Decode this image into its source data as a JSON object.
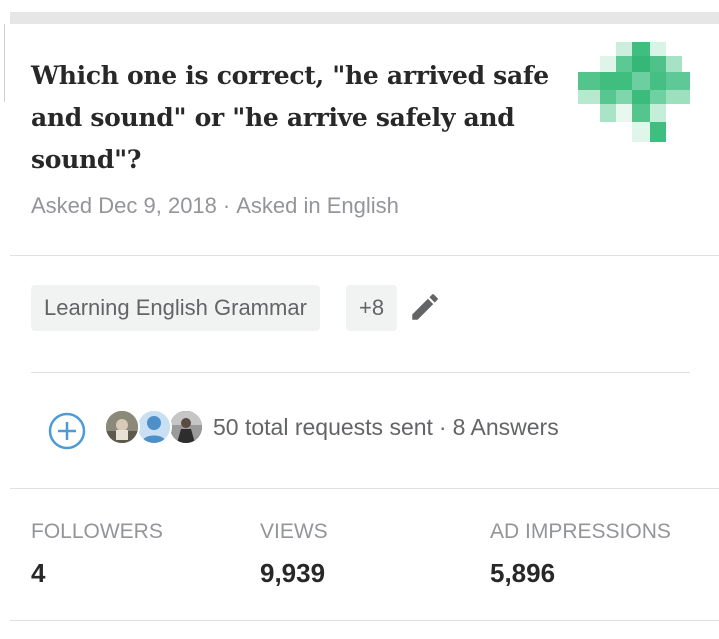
{
  "question": {
    "title": "Which one is correct, \"he arrived safe and sound\" or \"he arrive safely and sound\"?",
    "asked_date": "Asked Dec 9, 2018",
    "separator": "·",
    "asked_in": "Asked in English"
  },
  "topics": {
    "primary": "Learning English Grammar",
    "more_count": "+8"
  },
  "requests": {
    "total_text": "50 total requests sent",
    "separator": "·",
    "answers_text": "8 Answers"
  },
  "stats": [
    {
      "label": "FOLLOWERS",
      "value": "4"
    },
    {
      "label": "VIEWS",
      "value": "9,939"
    },
    {
      "label": "AD IMPRESSIONS",
      "value": "5,896"
    }
  ],
  "colors": {
    "accent_blue": "#4d9bd6",
    "pixel_green": "#3fbf7f",
    "text_primary": "#282829",
    "text_secondary": "#939598"
  },
  "icons": {
    "edit": "pencil-icon",
    "add": "plus-circle-icon"
  }
}
